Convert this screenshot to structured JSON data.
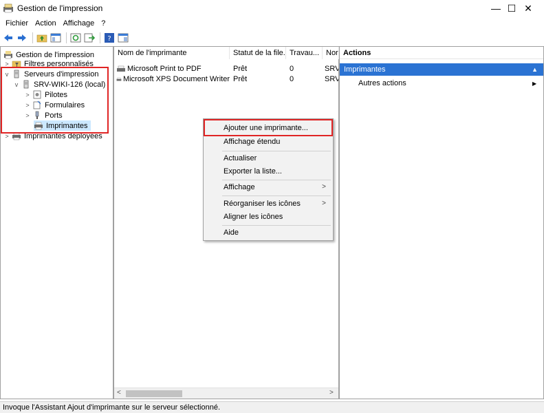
{
  "window": {
    "title": "Gestion de l'impression",
    "minimize_glyph": "—",
    "maximize_glyph": "☐",
    "close_glyph": "✕"
  },
  "menu": [
    "Fichier",
    "Action",
    "Affichage",
    "?"
  ],
  "toolbar": {
    "icons": [
      "back-icon",
      "forward-icon",
      "up-folder-icon",
      "show-hide-tree-icon",
      "refresh-icon",
      "export-list-icon",
      "help-icon",
      "mmc-icon"
    ]
  },
  "tree": {
    "items": [
      {
        "label": "Gestion de l'impression",
        "icon": "print-management-icon"
      },
      {
        "label": "Filtres personnalisés",
        "icon": "filter-folder-icon",
        "chevron": ">"
      },
      {
        "label": "Serveurs d'impression",
        "icon": "server-icon",
        "chevron": "v"
      },
      {
        "label": "SRV-WIKI-126 (local)",
        "icon": "server-icon",
        "chevron": "v"
      },
      {
        "label": "Pilotes",
        "icon": "driver-icon",
        "chevron": ">"
      },
      {
        "label": "Formulaires",
        "icon": "forms-icon",
        "chevron": ">"
      },
      {
        "label": "Ports",
        "icon": "port-icon",
        "chevron": ">"
      },
      {
        "label": "Imprimantes",
        "icon": "printer-icon"
      },
      {
        "label": "Imprimantes déployées",
        "icon": "printer-icon",
        "chevron": ">"
      }
    ]
  },
  "list": {
    "columns": [
      "Nom de l'imprimante",
      "Statut de la file...",
      "Travau...",
      "Nor"
    ],
    "rows": [
      {
        "name": "Microsoft Print to PDF",
        "status": "Prêt",
        "jobs": "0",
        "server": "SRV"
      },
      {
        "name": "Microsoft XPS Document Writer",
        "status": "Prêt",
        "jobs": "0",
        "server": "SRV"
      }
    ]
  },
  "context_menu": {
    "items": [
      {
        "label": "Ajouter une imprimante..."
      },
      {
        "label": "Affichage étendu"
      },
      {
        "label": "Actualiser"
      },
      {
        "label": "Exporter la liste..."
      },
      {
        "label": "Affichage",
        "submenu": ">"
      },
      {
        "label": "Réorganiser les icônes",
        "submenu": ">"
      },
      {
        "label": "Aligner les icônes"
      },
      {
        "label": "Aide"
      }
    ]
  },
  "actions": {
    "header": "Actions",
    "section": "Imprimantes",
    "section_arrow": "▲",
    "more": "Autres actions",
    "more_arrow": "▶"
  },
  "scrollbar": {
    "left_arrow": "<",
    "right_arrow": ">"
  },
  "status_bar": "Invoque l'Assistant Ajout d'imprimante sur le serveur sélectionné.",
  "colors": {
    "highlight_box": "#e02424",
    "actions_section_bg": "#2b73d3",
    "selected_tree_bg": "#cce8ff"
  }
}
